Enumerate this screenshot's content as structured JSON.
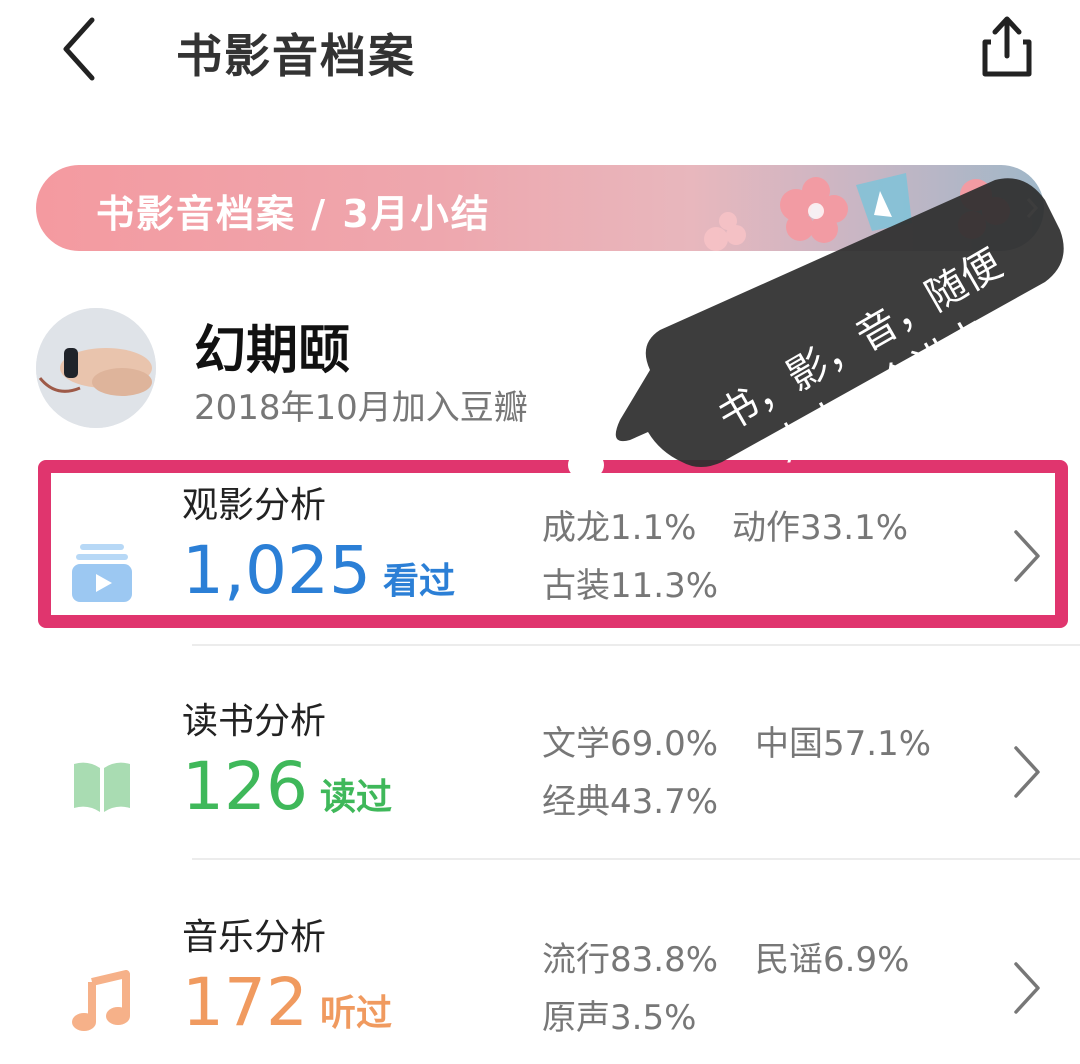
{
  "header": {
    "title": "书影音档案",
    "back_icon": "chevron-left-icon",
    "share_icon": "share-icon"
  },
  "banner": {
    "title": "书影音档案 / 3月小结",
    "colors": [
      "#f49aa0",
      "#e8b7bd",
      "#9fb7c8"
    ]
  },
  "profile": {
    "name": "幻期颐",
    "joined": "2018年10月加入豆瓣"
  },
  "cards": [
    {
      "title": "观影分析",
      "count": "1,025",
      "unit": "看过",
      "color": "#2b7fd6",
      "icon": "film-icon",
      "tags": [
        "成龙1.1%",
        "动作33.1%",
        "古装11.3%"
      ]
    },
    {
      "title": "读书分析",
      "count": "126",
      "unit": "读过",
      "color": "#3fb85a",
      "icon": "book-icon",
      "tags": [
        "文学69.0%",
        "中国57.1%",
        "经典43.7%"
      ]
    },
    {
      "title": "音乐分析",
      "count": "172",
      "unit": "听过",
      "color": "#f09a5f",
      "icon": "music-note-icon",
      "tags": [
        "流行83.8%",
        "民谣6.9%",
        "原声3.5%"
      ]
    }
  ],
  "annotation": {
    "line1": "书，影，音，随便",
    "line2": "点击一个进去",
    "highlight_color": "#e0356e"
  }
}
